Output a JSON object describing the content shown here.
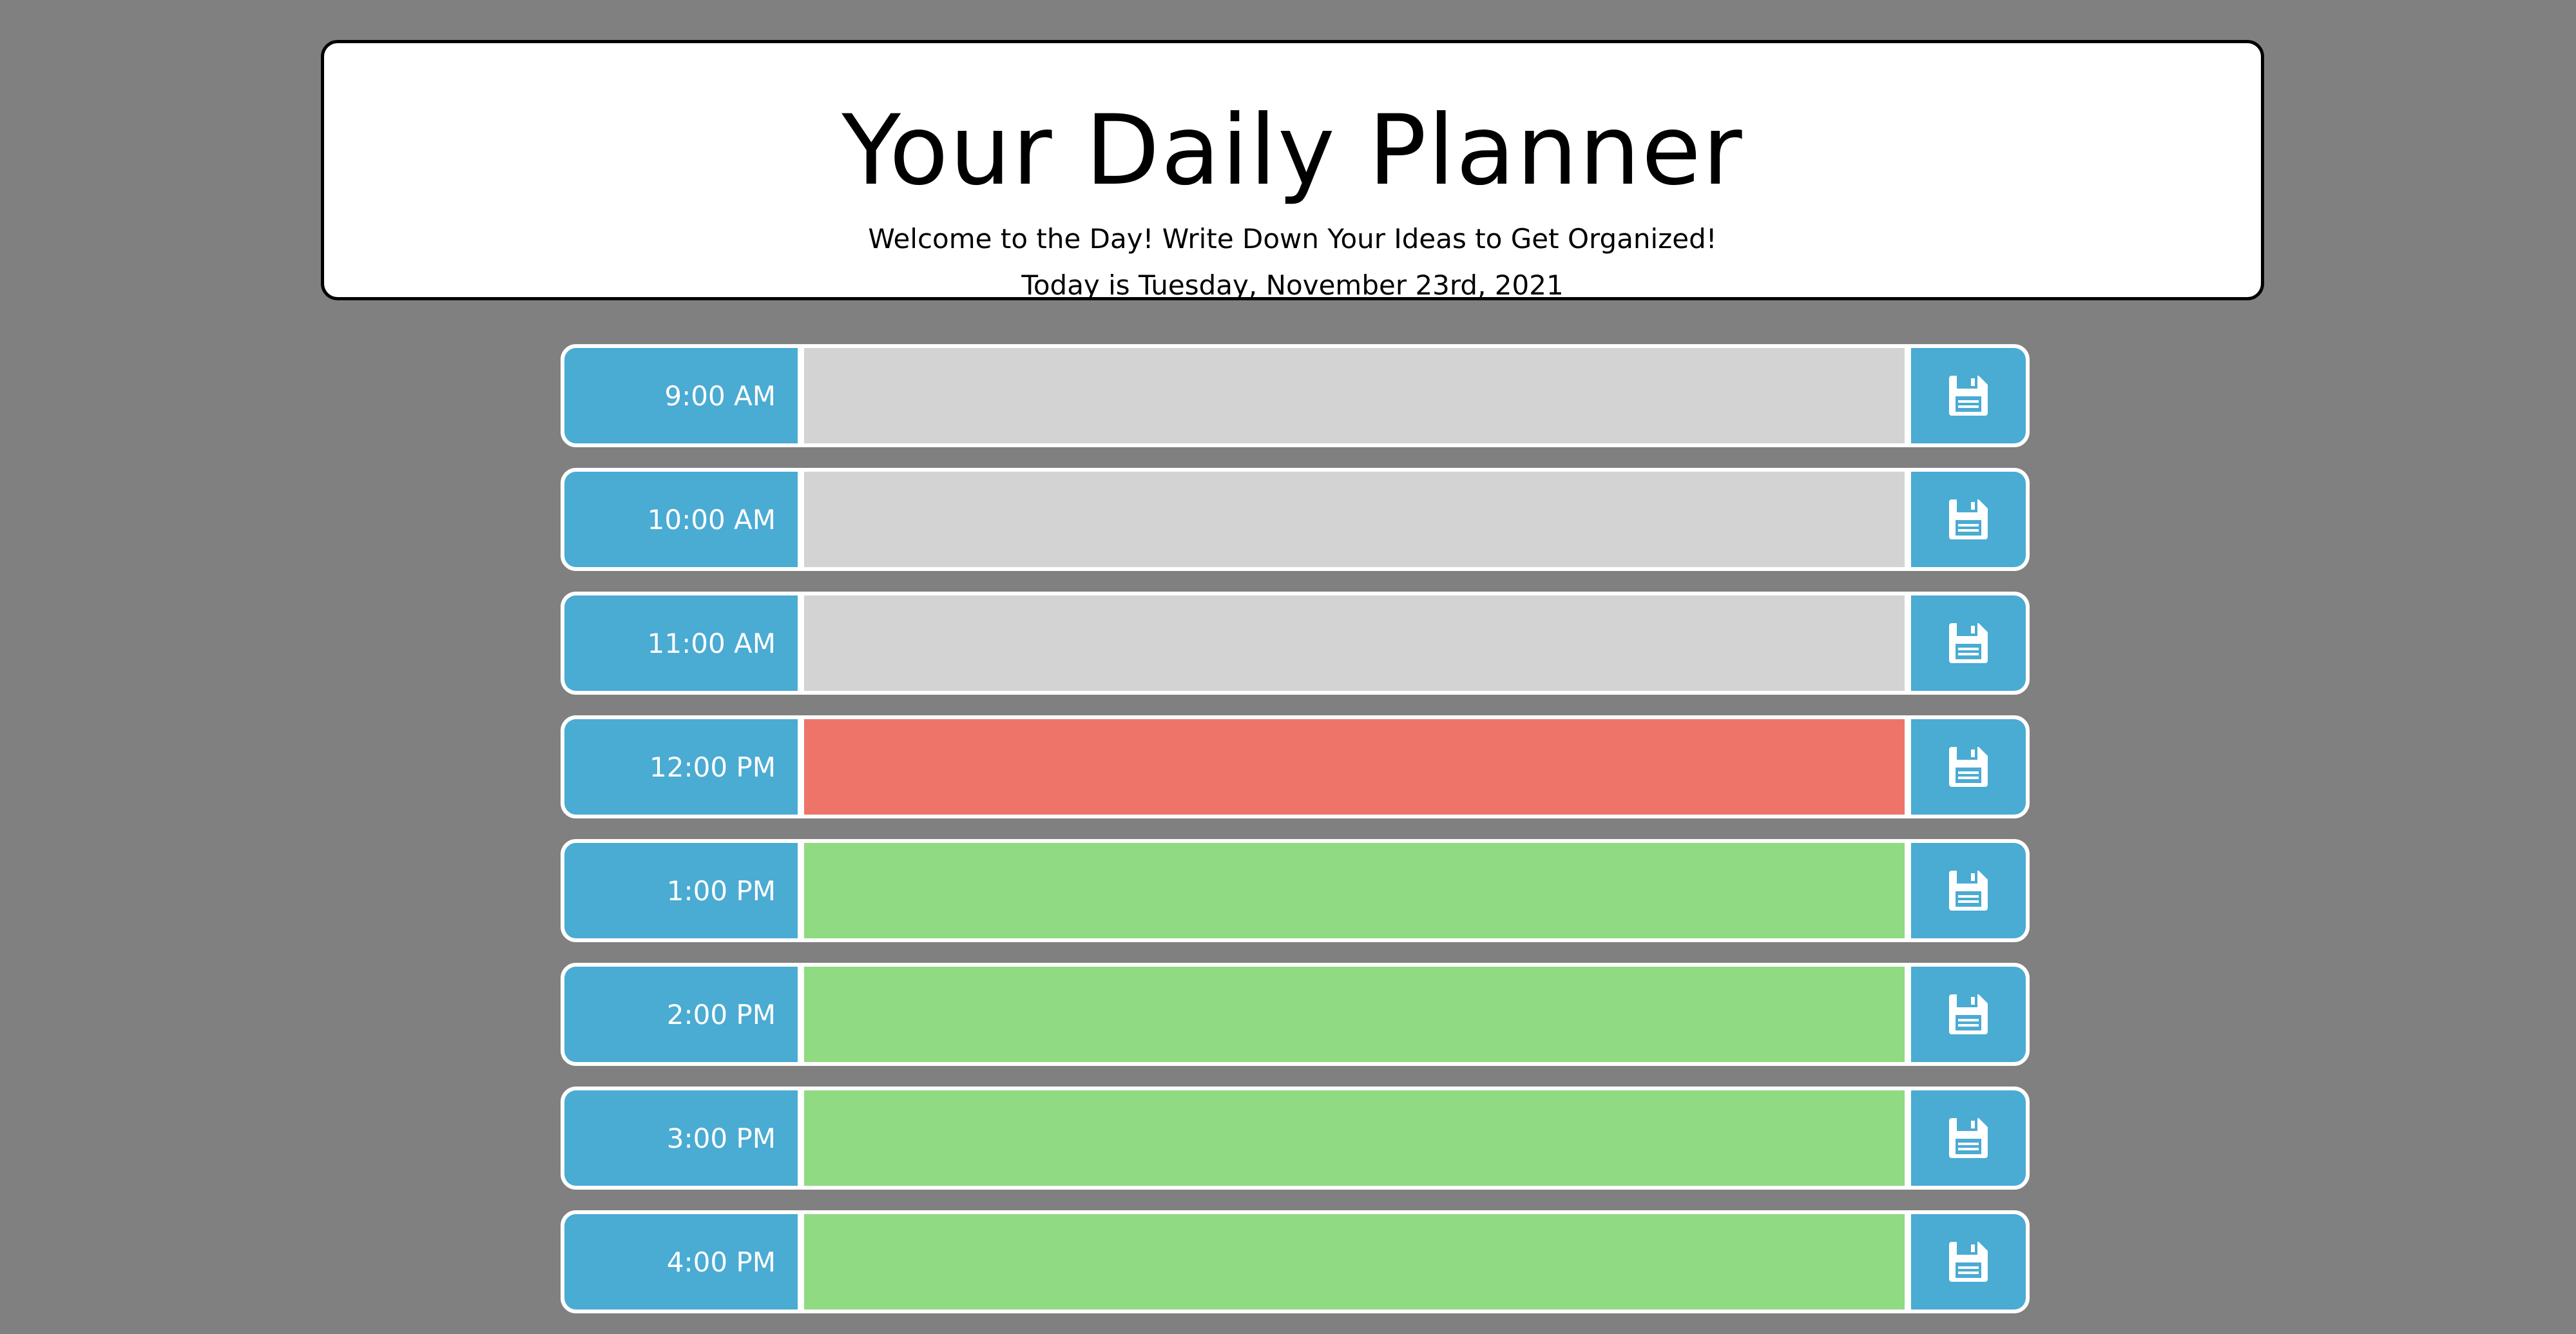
{
  "header": {
    "title": "Your Daily Planner",
    "subtitle": "Welcome to the Day! Write Down Your Ideas to Get Organized!",
    "date_text": "Today is Tuesday, November 23rd, 2021"
  },
  "colors": {
    "background": "#808080",
    "past": "#d3d3d3",
    "present": "#ee746a",
    "future": "#90da82",
    "hour_and_save": "#4aabd3"
  },
  "save_icon": "save-icon",
  "timeblocks": [
    {
      "hour": "9:00 AM",
      "status": "past",
      "text": ""
    },
    {
      "hour": "10:00 AM",
      "status": "past",
      "text": ""
    },
    {
      "hour": "11:00 AM",
      "status": "past",
      "text": ""
    },
    {
      "hour": "12:00 PM",
      "status": "present",
      "text": ""
    },
    {
      "hour": "1:00 PM",
      "status": "future",
      "text": ""
    },
    {
      "hour": "2:00 PM",
      "status": "future",
      "text": ""
    },
    {
      "hour": "3:00 PM",
      "status": "future",
      "text": ""
    },
    {
      "hour": "4:00 PM",
      "status": "future",
      "text": ""
    }
  ]
}
